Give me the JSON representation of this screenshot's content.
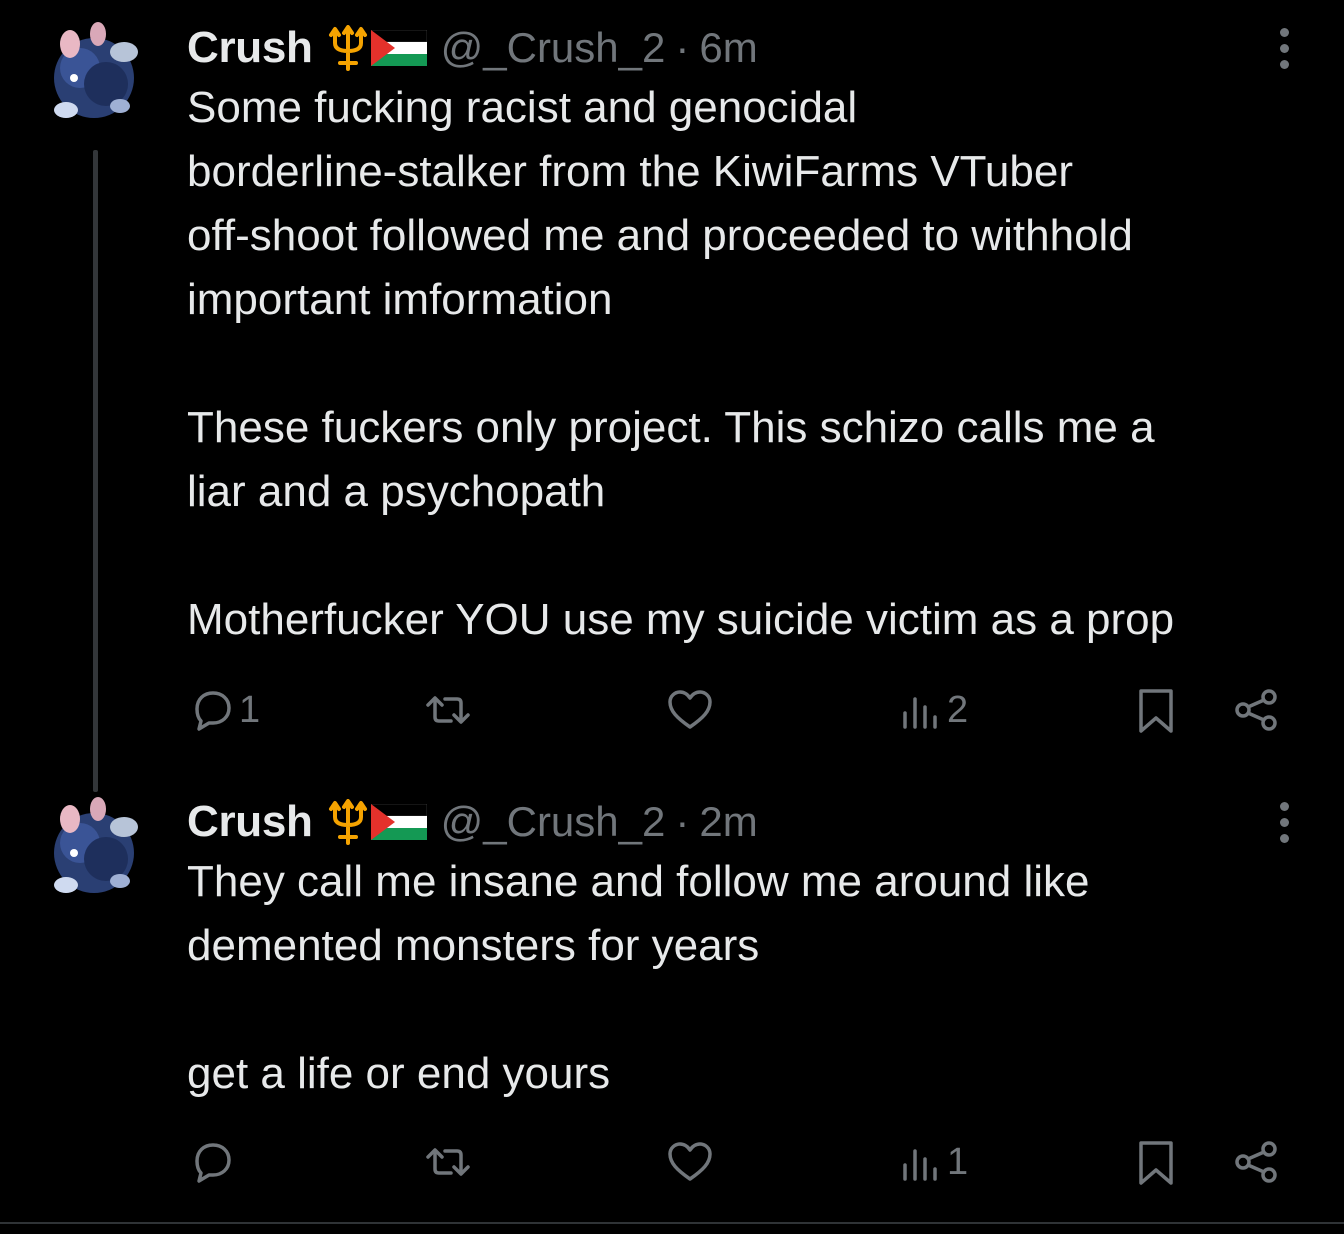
{
  "colors": {
    "background": "#000000",
    "text_primary": "#e7e9ea",
    "text_secondary": "#71767b",
    "thread_line": "#333639",
    "trident": "#f5a300"
  },
  "tweets": [
    {
      "display_name": "Crush",
      "badge_icons": [
        "trident-emoji",
        "palestine-flag-emoji"
      ],
      "handle": "@_Crush_2",
      "separator": "·",
      "timestamp": "6m",
      "text": "Some fucking racist and genocidal\nborderline-stalker from the KiwiFarms VTuber\noff-shoot followed me and proceeded to withhold\nimportant imformation\n\nThese fuckers only project. This schizo calls me a\nliar and a psychopath\n\nMotherfucker YOU use my suicide victim as a prop",
      "replies": "1",
      "views": "2"
    },
    {
      "display_name": "Crush",
      "badge_icons": [
        "trident-emoji",
        "palestine-flag-emoji"
      ],
      "handle": "@_Crush_2",
      "separator": "·",
      "timestamp": "2m",
      "text": "They call me insane and follow me around like\ndemented monsters for years\n\nget a life or end yours",
      "replies": "",
      "views": "1"
    }
  ]
}
